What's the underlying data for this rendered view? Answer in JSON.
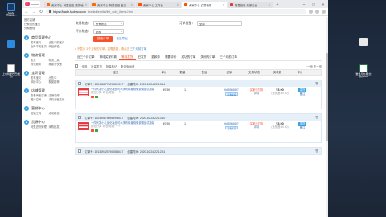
{
  "browser": {
    "tabs": [
      {
        "label": "卖家中心-阿里巴巴 退货地址",
        "color": "#ff6a00",
        "active": false
      },
      {
        "label": "卖家中心-阿里巴巴 宝贝",
        "color": "#ff6a00",
        "active": false
      },
      {
        "label": "卖家中心-工作台",
        "color": "#ff5000",
        "active": false
      },
      {
        "label": "卖家中心-交易管理",
        "color": "#ff5000",
        "active": true
      },
      {
        "label": "阿里巴巴 商家后台",
        "color": "#e53935",
        "active": false
      }
    ],
    "url_host": "https://trade.taobao.com",
    "url_path": "/trade/itemlist/list_sold_items.htm"
  },
  "sidebar": {
    "top_links": [
      "官方店铺",
      "已卖出的宝贝",
      "分期管理"
    ],
    "sections": [
      {
        "title": "商品管理中心",
        "items": [
          "发布宝贝",
          "出售中的宝贝",
          "仓库中的宝贝",
          "商品体检"
        ]
      },
      {
        "title": "物流管理",
        "items": [
          "发货",
          "物流工具",
          "物流服务",
          "我要寄快递"
        ]
      },
      {
        "title": "宝贝管理",
        "items": [
          "发布宝贝",
          "出售中",
          "体检中心",
          "橱窗推荐"
        ]
      },
      {
        "title": "店铺管理",
        "items": [
          "查看淘宝店铺",
          "店铺装修",
          "图片空间",
          "手机淘宝店铺"
        ]
      },
      {
        "title": "营销中心",
        "items": [
          "营销工具",
          "活动报名"
        ]
      },
      {
        "title": "货源中心",
        "items": [
          "阿里进货管理",
          "采购批发"
        ]
      }
    ]
  },
  "filters": {
    "row1": [
      {
        "label": "交易状态：",
        "value": "所有状态"
      },
      {
        "label": "订单类型：",
        "value": "全部"
      }
    ],
    "row2": [
      {
        "label": "评价状态：",
        "value": "全部"
      }
    ],
    "search_label": "搜索订单",
    "reset_label": "批量导出"
  },
  "notice": "● 不显示 3 个月前的订单，如需查看，请点击",
  "notice_link": "三个月前订单",
  "status_tabs": [
    "近三个月订单",
    "等待买家付款",
    "等待发货",
    "已发货",
    "退款中",
    "需要评价",
    "成功的订单",
    "关闭的订单",
    "三个月前订单"
  ],
  "active_tab_index": 2,
  "toolbar": {
    "select_all": "全选",
    "batch_ship": "批量发货",
    "batch_memo": "批量标记",
    "batch_confirm": "批量免运费",
    "pager": "上一页  下一页"
  },
  "columns": [
    "宝贝",
    "单价",
    "数量",
    "售后",
    "买家",
    "交易状态",
    "实收款",
    "评价"
  ],
  "orders": [
    {
      "order_no": "订单号: 1924588770295834917",
      "created": "创建时间: 2020-10-24 22:13:14",
      "product": "一件代发小礼品化妆品可水洗布料缠绕免费赠品试用装",
      "attr": "颜色分类: 粉色 规格: 一个",
      "price": "¥3.90",
      "qty": "1",
      "aftersale": "",
      "buyer": "tb88986897",
      "buyer_badge": "和我联系",
      "status": "买家已付款",
      "status_link": "详情",
      "total": "¥3.90",
      "ship_fee": "(含快递:¥0.00)",
      "op_btn": "发货",
      "op_link": "备注"
    },
    {
      "order_no": "订单号: 1924598750955998417",
      "created": "创建时间: 2020-10-24 22:13:10",
      "product": "一件代发小礼品化妆品可水洗布料缠绕免费赠品试用装",
      "attr": "颜色分类: 粉色 规格: 一个",
      "price": "¥3.90",
      "qty": "1",
      "aftersale": "",
      "buyer": "tb88986897",
      "buyer_badge": "和我联系",
      "status": "买家已付款",
      "status_link": "详情",
      "total": "¥3.90",
      "ship_fee": "(含快递:¥0.00)",
      "op_btn": "发货",
      "op_link": "备注"
    },
    {
      "order_no": "订单号: 1913694257905588417",
      "created": "创建时间: 2020-10-24 22:12:51",
      "product": "",
      "attr": "",
      "price": "",
      "qty": "",
      "aftersale": "",
      "buyer": "",
      "buyer_badge": "",
      "status": "",
      "status_link": "",
      "total": "",
      "ship_fee": "",
      "op_btn": "",
      "op_link": ""
    }
  ],
  "desktop": {
    "left_icons": [
      "Adobe Photosh...",
      "",
      "上市阿里巴巴(发布)"
    ],
    "right_icons": [
      "",
      "数量与交易(交换).xlsx"
    ]
  },
  "colors": {
    "accent": "#f5532d",
    "link": "#3b6fb6",
    "tab_active": "#f5532d"
  }
}
